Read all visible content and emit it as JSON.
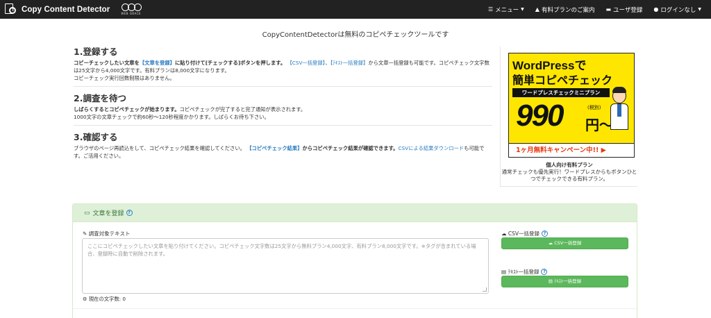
{
  "navbar": {
    "brand": "Copy Content Detector",
    "partner_logo_text": "WEB GRACE",
    "items": [
      {
        "icon": "menu-bars-icon",
        "glyph": "☰",
        "label": "メニュー"
      },
      {
        "icon": "graduation-cap-icon",
        "glyph": "🎓",
        "label": "有料プランのご案内"
      },
      {
        "icon": "folder-icon",
        "glyph": "▬",
        "label": "ユーザ登録"
      },
      {
        "icon": "user-icon",
        "glyph": "●",
        "label": "ログインなし"
      }
    ]
  },
  "page_title": "CopyContentDetectorは無料のコピペチェックツールです",
  "steps": [
    {
      "title": "1.登録する",
      "lead": "コピーチェックしたい文章を",
      "link1": "【文章を登録】",
      "mid1": "に貼り付けて[チェックする]ボタンを押します。",
      "link2": "【CSV一括登録】",
      "sep": "、",
      "link3": "【ﾃｷｽﾄ一括登録】",
      "tail": "から文章一括登録も可能です。コピペチェック文字数は25文字から4,000文字です。有料プランは8,000文字になります。",
      "line2": "コピーチェック実行回数制限はありません。"
    },
    {
      "title": "2.調査を待つ",
      "lead": "しばらくするとコピペチェックが始まります。",
      "tail": "コピペチェックが完了すると完了通知が表示されます。",
      "line2": "1000文字の文章チェックで約60秒〜120秒程度かかります。しばらくお待ち下さい。"
    },
    {
      "title": "3.確認する",
      "lead": "ブラウザのページ再読込をして、コピペチェック結果を確認してください。",
      "link1": "【コピペチェック結果】",
      "mid1": "からコピペチェック結果が確認できます。",
      "link2": "CSVによる結果ダウンロード",
      "tail": "も可能です。ご活用ください。"
    }
  ],
  "ad": {
    "line1": "WordPressで",
    "line2": "簡単コピペチェック",
    "line3": "ワードプレスチェックミニプラン",
    "price": "990",
    "tax": "(税別)",
    "yen": "円〜",
    "banner": "1ヶ月無料キャンペーン中!! ▶",
    "caption_title": "個人向け有料プラン",
    "caption_body": "通常チェックも優先実行！ワードプレスからもボタンひとつでチェックできる有料プラン。"
  },
  "panel": {
    "title": "文章を登録",
    "help": "?",
    "field_label": "調査対象テキスト",
    "placeholder": "ここにコピペチェックしたい文章を貼り付けてください。コピペチェック文字数は25文字から無料プラン4,000文字、有料プラン8,000文字です。※タグが含まれている場合、登録時に自動で削除されます。",
    "char_count_label": "現在の文字数: 0",
    "csv_label": "CSV一括登録",
    "csv_button": "CSV一括登録",
    "text_label": "ﾃｷｽﾄ一括登録",
    "text_button": "ﾃｷｽﾄ一括登録"
  },
  "colors": {
    "navbar": "#222222",
    "panel_head": "#dff0d8",
    "button_green": "#5cb85c",
    "link": "#2a7bc0",
    "ad_yellow": "#ffe600"
  }
}
